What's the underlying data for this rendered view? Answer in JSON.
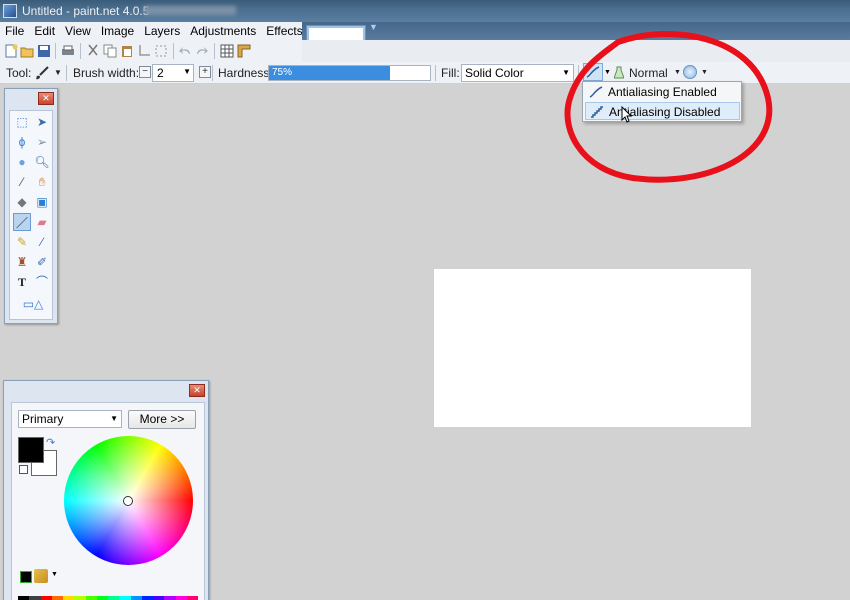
{
  "window": {
    "title": "Untitled - paint.net 4.0.5"
  },
  "menu": {
    "items": [
      "File",
      "Edit",
      "View",
      "Image",
      "Layers",
      "Adjustments",
      "Effects"
    ]
  },
  "toolbar": {
    "tool_label": "Tool:",
    "brush_width_label": "Brush width:",
    "brush_width_value": "2",
    "hardness_label": "Hardness:",
    "hardness_value": "75%",
    "hardness_fraction": 0.75,
    "fill_label": "Fill:",
    "fill_value": "Solid Color",
    "blend_mode": "Normal"
  },
  "antialias_menu": {
    "enabled_label": "Antialiasing Enabled",
    "disabled_label": "Antialiasing Disabled",
    "highlighted": "Antialiasing Disabled"
  },
  "colors": {
    "mode_value": "Primary",
    "more_label": "More >>",
    "primary_color": "#000000",
    "secondary_color": "#ffffff",
    "palette": [
      "#000000",
      "#404040",
      "#ff0000",
      "#ff6a00",
      "#ffd800",
      "#b6ff00",
      "#4cff00",
      "#00ff21",
      "#00ff90",
      "#00ffff",
      "#0094ff",
      "#0026ff",
      "#4800ff",
      "#b200ff",
      "#ff00dc",
      "#ff006e"
    ]
  },
  "annotation": {
    "color": "#e8101a"
  }
}
